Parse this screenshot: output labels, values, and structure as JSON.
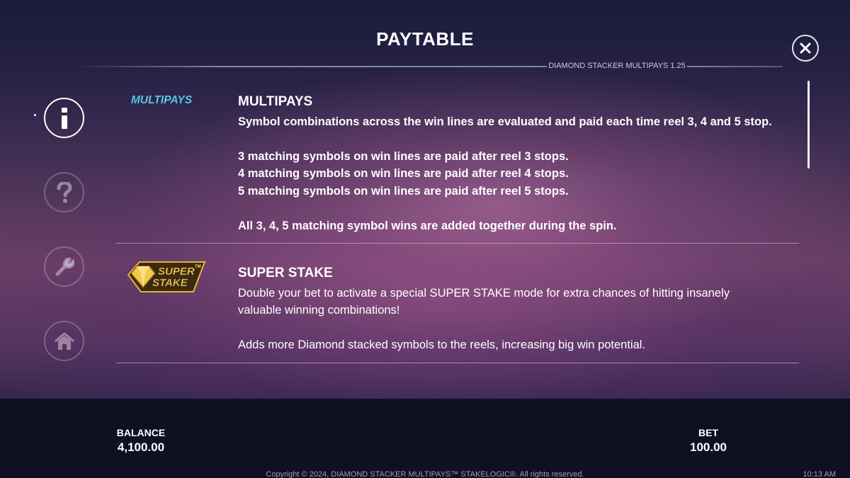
{
  "header": {
    "title": "PAYTABLE",
    "version": "DIAMOND STACKER MULTIPAYS 1.25",
    "close_icon": "close-icon"
  },
  "nav": [
    {
      "icon": "info-icon",
      "active": true
    },
    {
      "icon": "question-icon",
      "active": false
    },
    {
      "icon": "wrench-icon",
      "active": false
    },
    {
      "icon": "home-icon",
      "active": false
    }
  ],
  "sections": [
    {
      "logo_text": "MULTIPAYS",
      "heading": "MULTIPAYS",
      "paragraphs": [
        "Symbol combinations across the win lines are evaluated and paid each time reel 3, 4 and 5 stop.",
        "3 matching symbols on win lines are paid after reel 3 stops.",
        "4 matching symbols on win lines are paid after reel 4 stops.",
        "5 matching symbols on win lines are paid after reel 5 stops.",
        "All 3, 4, 5 matching symbol wins are added together during the spin."
      ]
    },
    {
      "logo_text": [
        "SUPER",
        "STAKE",
        "TM"
      ],
      "heading": "SUPER STAKE",
      "paragraphs": [
        "Double your bet to activate a special SUPER STAKE mode for extra chances of hitting insanely",
        "valuable winning combinations!",
        "Adds more Diamond stacked symbols to the reels, increasing big win potential."
      ]
    }
  ],
  "footer": {
    "balance_label": "BALANCE",
    "balance_value": "4,100.00",
    "bet_label": "BET",
    "bet_value": "100.00",
    "copyright": "Copyright © 2024, DIAMOND STACKER MULTIPAYS™ STAKELOGIC®. All rights reserved.",
    "clock": "10:13 AM"
  },
  "colors": {
    "multipays_logo": "#6fd3ef",
    "superstake_gold": "#e6b43a",
    "footer_bg": "#0f1022"
  }
}
